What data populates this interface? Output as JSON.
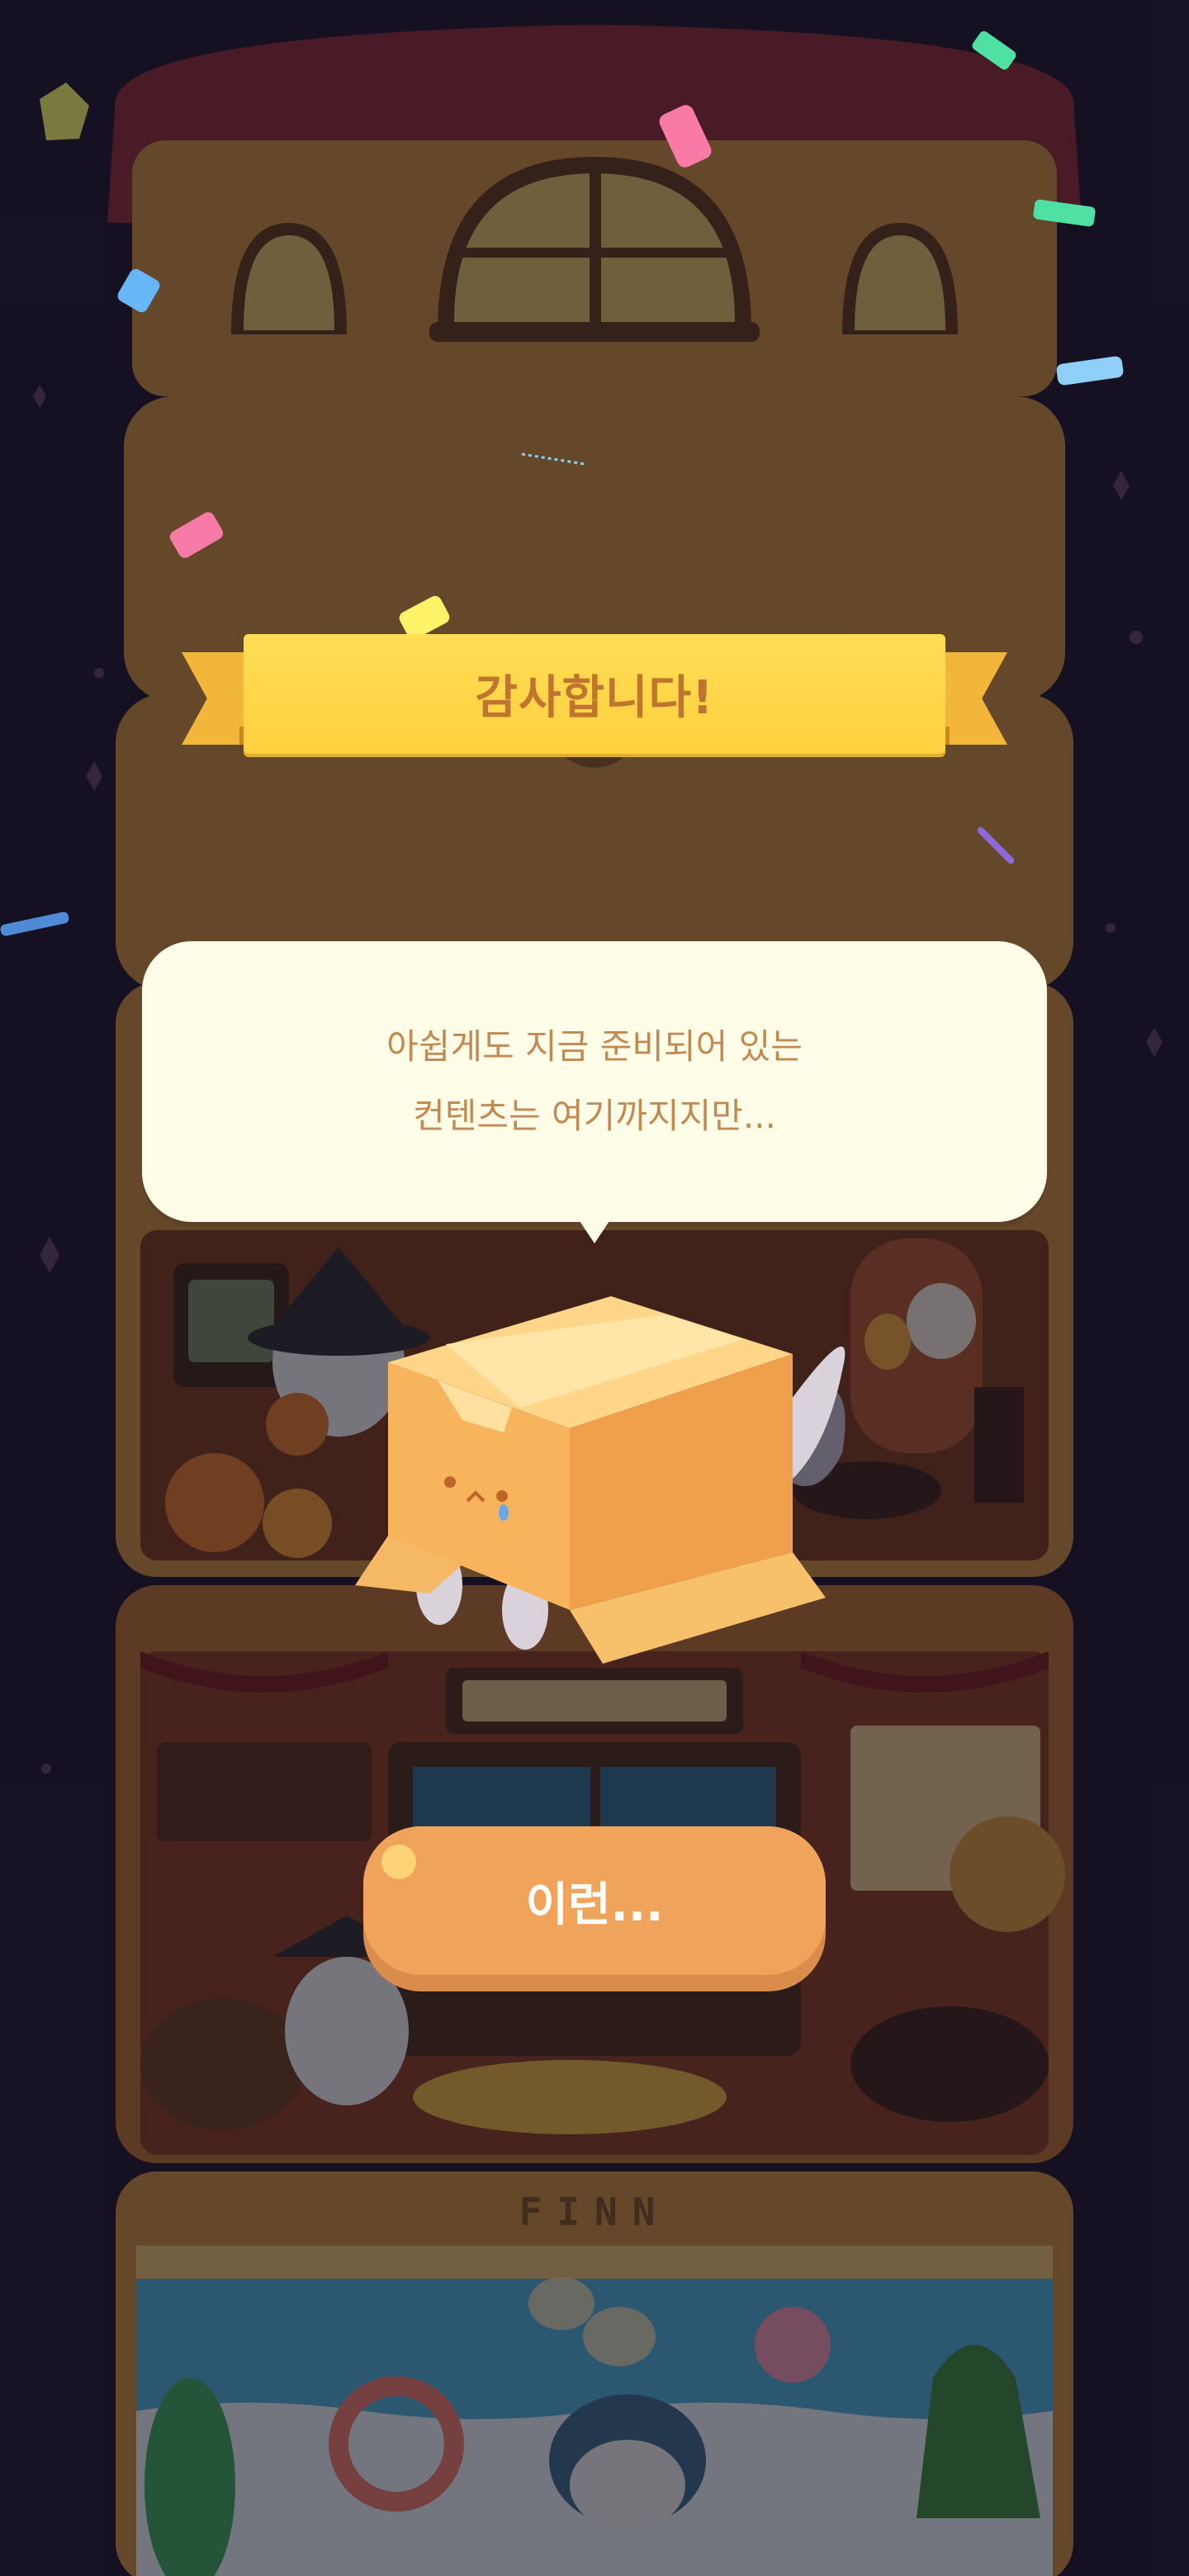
{
  "banner": {
    "title": "감사합니다!"
  },
  "dialog": {
    "line1": "아쉽게도 지금 준비되어 있는",
    "line2": "컨텐츠는 여기까지지만..."
  },
  "button": {
    "label": "이런..."
  },
  "sign": {
    "text": "FINN"
  },
  "colors": {
    "background": "#1b1628",
    "ribbon": "#ffd44a",
    "ribbon_text": "#c0752e",
    "bubble": "#fffde8",
    "bubble_text": "#c28a52",
    "button": "#f0a35a",
    "button_text": "#ffffff",
    "box": "#f5b45e"
  }
}
